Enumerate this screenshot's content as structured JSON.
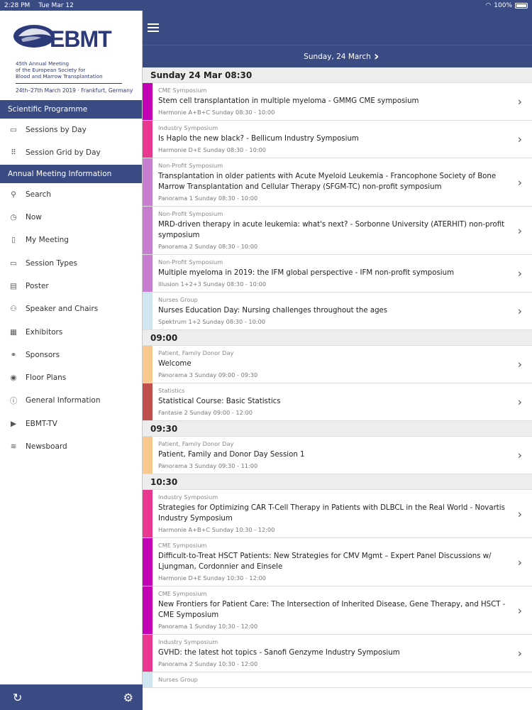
{
  "statusbar": {
    "time": "2:28 PM",
    "date": "Tue Mar 12",
    "battery": "100%"
  },
  "logo": {
    "name": "EBMT",
    "subtitle_lines": [
      "45th Annual Meeting",
      "of the European Society for",
      "Blood and Marrow Transplantation"
    ],
    "dates": "24th–27th March 2019 · Frankfurt, Germany"
  },
  "sidebar": {
    "section1": "Scientific Programme",
    "items1": [
      {
        "label": "Sessions by Day",
        "icon": "calendar-icon"
      },
      {
        "label": "Session Grid by Day",
        "icon": "grid-icon"
      }
    ],
    "section2": "Annual Meeting Information",
    "items2": [
      {
        "label": "Search",
        "icon": "search-icon"
      },
      {
        "label": "Now",
        "icon": "clock-icon"
      },
      {
        "label": "My Meeting",
        "icon": "bookmark-icon"
      },
      {
        "label": "Session Types",
        "icon": "folder-icon"
      },
      {
        "label": "Poster",
        "icon": "poster-icon"
      },
      {
        "label": "Speaker and Chairs",
        "icon": "people-icon"
      },
      {
        "label": "Exhibitors",
        "icon": "exhibitor-icon"
      },
      {
        "label": "Sponsors",
        "icon": "handshake-icon"
      },
      {
        "label": "Floor Plans",
        "icon": "compass-icon"
      },
      {
        "label": "General Information",
        "icon": "info-icon"
      },
      {
        "label": "EBMT-TV",
        "icon": "play-icon"
      },
      {
        "label": "Newsboard",
        "icon": "rss-icon"
      }
    ]
  },
  "header": {
    "date": "Sunday, 24 March"
  },
  "groups": [
    {
      "time": "Sunday 24 Mar 08:30",
      "sessions": [
        {
          "code": "IS1",
          "color": "#c400b4",
          "type": "CME Symposium",
          "title": "Stem cell transplantation in multiple myeloma - GMMG CME symposium",
          "meta": "Harmonie A+B+C Sunday 08:30 - 10:00"
        },
        {
          "code": "IS2",
          "color": "#e8388f",
          "type": "Industry Symposium",
          "title": "Is Haplo the new black? - Bellicum Industry Symposium",
          "meta": "Harmonie D+E Sunday 08:30 - 10:00"
        },
        {
          "code": "IS3",
          "color": "#c77ed0",
          "type": "Non-Profit Symposium",
          "title": "Transplantation in older patients with Acute Myeloid Leukemia - Francophone Society of Bone Marrow Transplantation and Cellular Therapy (SFGM-TC) non-profit symposium",
          "meta": "Panorama 1 Sunday 08:30 - 10:00"
        },
        {
          "code": "IS4",
          "color": "#c77ed0",
          "type": "Non-Profit Symposium",
          "title": "MRD-driven therapy in acute leukemia: what's next? - Sorbonne University (ATERHIT) non-profit symposium",
          "meta": "Panorama 2 Sunday 08:30 - 10:00"
        },
        {
          "code": "IS5",
          "color": "#c77ed0",
          "type": "Non-Profit Symposium",
          "title": "Multiple myeloma in 2019: the IFM global perspective - IFM non-profit symposium",
          "meta": "Illusion 1+2+3 Sunday 08:30 - 10:00"
        },
        {
          "code": "NG01",
          "color": "#cfe6f0",
          "type": "Nurses Group",
          "title": "Nurses Education Day: Nursing challenges throughout the ages",
          "meta": "Spektrum 1+2 Sunday 08:30 - 10:00"
        }
      ]
    },
    {
      "time": "09:00",
      "sessions": [
        {
          "code": "PFD0",
          "color": "#f7c98e",
          "type": "Patient, Family Donor Day",
          "title": "Welcome",
          "meta": "Panorama 3 Sunday 09:00 - 09:30"
        },
        {
          "code": "Stat1",
          "color": "#c0504d",
          "type": "Statistics",
          "title": "Statistical Course: Basic Statistics",
          "meta": "Fantasie 2 Sunday 09:00 - 12:00"
        }
      ]
    },
    {
      "time": "09:30",
      "sessions": [
        {
          "code": "PFD1",
          "color": "#f7c98e",
          "type": "Patient, Family Donor Day",
          "title": "Patient, Family and Donor Day Session 1",
          "meta": "Panorama 3 Sunday 09:30 - 11:00"
        }
      ]
    },
    {
      "time": "10:30",
      "sessions": [
        {
          "code": "IS6",
          "color": "#e8388f",
          "type": "Industry Symposium",
          "title": "Strategies for Optimizing CAR T-Cell Therapy in Patients with DLBCL in the Real World - Novartis Industry Symposium",
          "meta": "Harmonie A+B+C Sunday 10:30 - 12:00"
        },
        {
          "code": "IS7",
          "color": "#c400b4",
          "type": "CME Symposium",
          "title": "Difficult-to-Treat HSCT Patients: New Strategies for CMV Mgmt – Expert Panel Discussions w/ Ljungman, Cordonnier and Einsele",
          "meta": "Harmonie D+E Sunday 10:30 - 12:00"
        },
        {
          "code": "IS8",
          "color": "#c400b4",
          "type": "CME Symposium",
          "title": "New Frontiers for Patient Care: The Intersection of Inherited Disease, Gene Therapy, and HSCT - CME Symposium",
          "meta": "Panorama 1 Sunday 10:30 - 12:00"
        },
        {
          "code": "IS9",
          "color": "#e8388f",
          "type": "Industry Symposium",
          "title": "GVHD: the latest hot topics - Sanofi Genzyme Industry Symposium",
          "meta": "Panorama 2 Sunday 10:30 - 12:00"
        },
        {
          "code": "",
          "color": "#cfe6f0",
          "type": "Nurses Group",
          "title": "",
          "meta": ""
        }
      ]
    }
  ]
}
